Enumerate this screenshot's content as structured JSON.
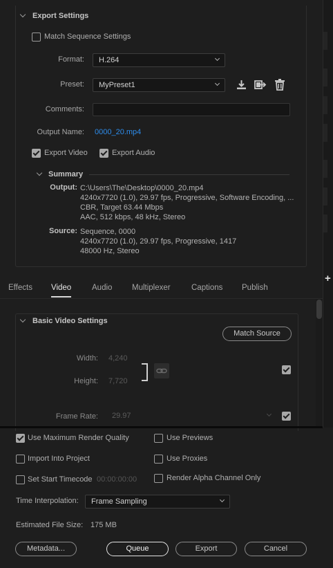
{
  "export_settings": {
    "title": "Export Settings",
    "match_sequence_label": "Match Sequence Settings",
    "match_sequence_checked": false,
    "format_label": "Format:",
    "format_value": "H.264",
    "preset_label": "Preset:",
    "preset_value": "MyPreset1",
    "comments_label": "Comments:",
    "comments_value": "",
    "output_name_label": "Output Name:",
    "output_name_value": "0000_20.mp4",
    "export_video_label": "Export Video",
    "export_video_checked": true,
    "export_audio_label": "Export Audio",
    "export_audio_checked": true
  },
  "summary": {
    "title": "Summary",
    "output_key": "Output:",
    "output_lines": [
      "C:\\Users\\The\\Desktop\\0000_20.mp4",
      "4240x7720 (1.0), 29.97 fps, Progressive, Software Encoding, ...",
      "CBR, Target 63.44 Mbps",
      "AAC, 512 kbps, 48 kHz, Stereo"
    ],
    "source_key": "Source:",
    "source_lines": [
      "Sequence, 0000",
      "4240x7720 (1.0), 29.97 fps, Progressive, 1417",
      "48000 Hz, Stereo"
    ]
  },
  "tabs": [
    {
      "label": "Effects",
      "active": false
    },
    {
      "label": "Video",
      "active": true
    },
    {
      "label": "Audio",
      "active": false
    },
    {
      "label": "Multiplexer",
      "active": false
    },
    {
      "label": "Captions",
      "active": false
    },
    {
      "label": "Publish",
      "active": false
    }
  ],
  "video_settings": {
    "title": "Basic Video Settings",
    "match_source_label": "Match Source",
    "width_label": "Width:",
    "width_value": "4,240",
    "height_label": "Height:",
    "height_value": "7,720",
    "size_checked": true,
    "frame_rate_label": "Frame Rate:",
    "frame_rate_value": "29.97",
    "frame_rate_checked": true
  },
  "options": {
    "use_max_render_label": "Use Maximum Render Quality",
    "use_max_render_checked": true,
    "use_previews_label": "Use Previews",
    "use_previews_checked": false,
    "import_into_project_label": "Import Into Project",
    "import_into_project_checked": false,
    "use_proxies_label": "Use Proxies",
    "use_proxies_checked": false,
    "set_start_timecode_label": "Set Start Timecode",
    "set_start_timecode_checked": false,
    "start_timecode_value": "00:00:00:00",
    "render_alpha_label": "Render Alpha Channel Only",
    "render_alpha_checked": false,
    "time_interpolation_label": "Time Interpolation:",
    "time_interpolation_value": "Frame Sampling",
    "estimated_size_label": "Estimated File Size:",
    "estimated_size_value": "175 MB"
  },
  "buttons": {
    "metadata": "Metadata...",
    "queue": "Queue",
    "export": "Export",
    "cancel": "Cancel"
  },
  "icons": {
    "save_preset": "download-icon",
    "import_preset": "import-preset-icon",
    "delete_preset": "trash-icon",
    "constrain": "link-icon"
  },
  "colors": {
    "link": "#2d8ceb",
    "background": "#1e1e1e"
  }
}
